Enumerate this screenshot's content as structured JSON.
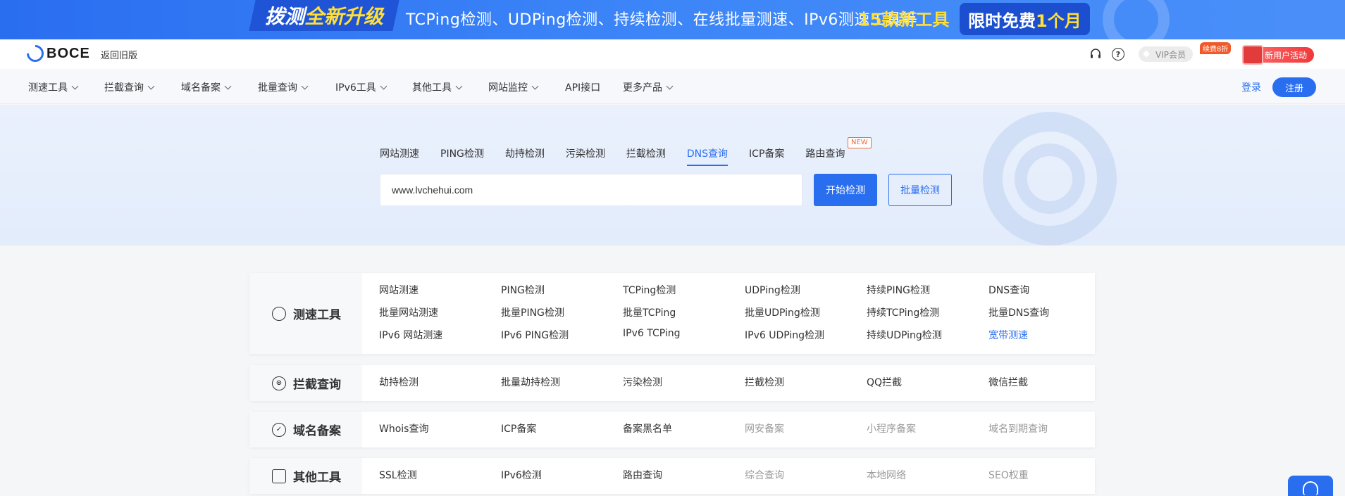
{
  "banner": {
    "left_white": "拨测",
    "left_yellow": "全新升级",
    "middle": "TCPing检测、UDPing检测、持续检测、在线批量测速、IPv6测速工具等",
    "highlight": "15款新工具",
    "right_white": "限时免费",
    "right_yellow": "1个月"
  },
  "header": {
    "logo_text": "BOCE",
    "back_old": "返回旧版",
    "vip_label": "VIP会员",
    "vip_tag": "续费8折",
    "new_user": "新用户活动",
    "help_glyph": "?"
  },
  "nav": {
    "items": [
      {
        "label": "测速工具",
        "dropdown": true
      },
      {
        "label": "拦截查询",
        "dropdown": true
      },
      {
        "label": "域名备案",
        "dropdown": true
      },
      {
        "label": "批量查询",
        "dropdown": true
      },
      {
        "label": "IPv6工具",
        "dropdown": true
      },
      {
        "label": "其他工具",
        "dropdown": true
      },
      {
        "label": "网站监控",
        "dropdown": true
      },
      {
        "label": "API接口",
        "dropdown": false
      },
      {
        "label": "更多产品",
        "dropdown": true
      }
    ],
    "login": "登录",
    "register": "注册"
  },
  "hero": {
    "tabs": [
      "网站测速",
      "PING检测",
      "劫持检测",
      "污染检测",
      "拦截检测",
      "DNS查询",
      "ICP备案",
      "路由查询"
    ],
    "active_tab": "DNS查询",
    "new_tag": "NEW",
    "input_value": "www.lvchehui.com",
    "start_button": "开始检测",
    "batch_button": "批量检测"
  },
  "sections": [
    {
      "title": "测速工具",
      "icon": "speedometer-icon",
      "rows": [
        [
          "网站测速",
          "PING检测",
          "TCPing检测",
          "UDPing检测",
          "持续PING检测",
          "DNS查询"
        ],
        [
          "批量网站测速",
          "批量PING检测",
          "批量TCPing",
          "批量UDPing检测",
          "持续TCPing检测",
          "批量DNS查询"
        ],
        [
          "IPv6 网站测速",
          "IPv6 PING检测",
          "IPv6 TCPing",
          "IPv6 UDPing检测",
          "持续UDPing检测",
          "宽带测速"
        ]
      ]
    },
    {
      "title": "拦截查询",
      "icon": "intercept-icon",
      "rows": [
        [
          "劫持检测",
          "批量劫持检测",
          "污染检测",
          "拦截检测",
          "QQ拦截",
          "微信拦截"
        ]
      ]
    },
    {
      "title": "域名备案",
      "icon": "shield-icon",
      "rows": [
        [
          "Whois查询",
          "ICP备案",
          "备案黑名单",
          "网安备案",
          "小程序备案",
          "域名到期查询"
        ]
      ]
    },
    {
      "title": "其他工具",
      "icon": "grid-icon",
      "rows": [
        [
          "SSL检测",
          "IPv6检测",
          "路由查询",
          "综合查询",
          "本地网络",
          "SEO权重"
        ]
      ]
    }
  ],
  "colors": {
    "accent": "#2a6ef0",
    "banner_yellow": "#ffdf38",
    "disabled_gray": "#999999",
    "tag_orange": "#f06b3a"
  }
}
